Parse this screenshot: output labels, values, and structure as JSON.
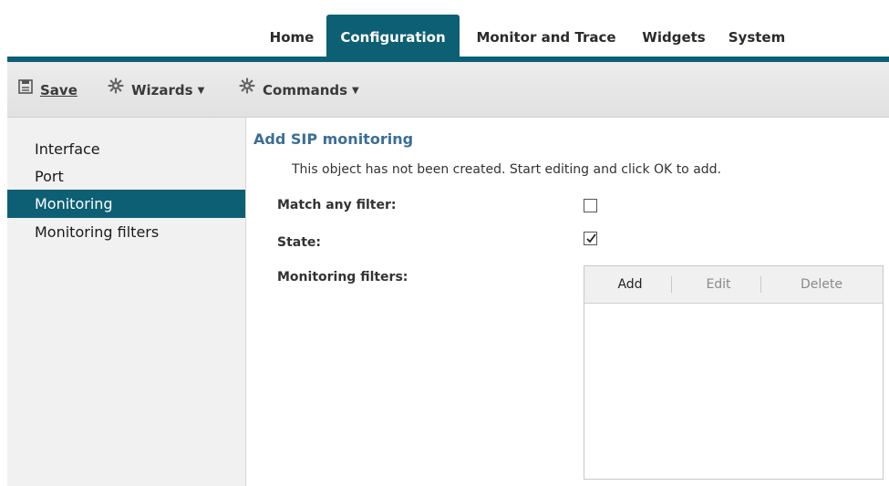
{
  "topnav": {
    "tabs": [
      {
        "label": "Home"
      },
      {
        "label": "Configuration"
      },
      {
        "label": "Monitor and Trace"
      },
      {
        "label": "Widgets"
      },
      {
        "label": "System"
      }
    ],
    "active_tab": "Configuration"
  },
  "toolbar": {
    "save_label": "Save",
    "wizards_label": "Wizards",
    "commands_label": "Commands"
  },
  "sidebar": {
    "items": [
      {
        "label": "Interface"
      },
      {
        "label": "Port"
      },
      {
        "label": "Monitoring"
      },
      {
        "label": "Monitoring filters"
      }
    ],
    "active_item": "Monitoring"
  },
  "main": {
    "title": "Add SIP monitoring",
    "notice": "This object has not been created. Start editing and click OK to add.",
    "fields": {
      "match_any_filter": {
        "label": "Match any filter:",
        "checked": false
      },
      "state": {
        "label": "State:",
        "checked": true
      },
      "monitoring_filters": {
        "label": "Monitoring filters:"
      }
    },
    "filters_table": {
      "add_label": "Add",
      "edit_label": "Edit",
      "delete_label": "Delete"
    }
  },
  "colors": {
    "accent": "#0d5f74",
    "title_blue": "#3b6e98",
    "toolbar_bg": "#e6e6e6",
    "sidebar_bg": "#f1f1f1"
  }
}
